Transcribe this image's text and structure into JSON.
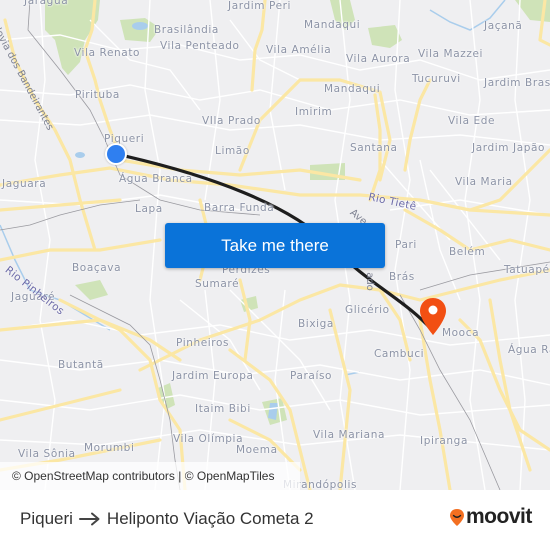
{
  "map": {
    "places": [
      {
        "name": "Jaraguá",
        "key": "jaragua"
      },
      {
        "name": "Jardim Peri",
        "key": "jardim-peri"
      },
      {
        "name": "Brasilândia",
        "key": "brasilandia"
      },
      {
        "name": "Vila Penteado",
        "key": "vila-penteado"
      },
      {
        "name": "Mandaqui",
        "key": "mandaqui-north"
      },
      {
        "name": "Jaçanã",
        "key": "jacana"
      },
      {
        "name": "Vila Renato",
        "key": "vila-renato"
      },
      {
        "name": "Vila Amélia",
        "key": "vila-amelia"
      },
      {
        "name": "Vila Aurora",
        "key": "vila-aurora"
      },
      {
        "name": "Vila Mazzei",
        "key": "vila-mazzei"
      },
      {
        "name": "Pirituba",
        "key": "pirituba"
      },
      {
        "name": "Tucuruvi",
        "key": "tucuruvi"
      },
      {
        "name": "Mandaqui",
        "key": "mandaqui"
      },
      {
        "name": "Jardim Brasil",
        "key": "jardim-brasil"
      },
      {
        "name": "Piqueri",
        "key": "piqueri"
      },
      {
        "name": "VIla Prado",
        "key": "vila-prado"
      },
      {
        "name": "Imirim",
        "key": "imirim"
      },
      {
        "name": "Vila Ede",
        "key": "vila-ede"
      },
      {
        "name": "Limão",
        "key": "limao"
      },
      {
        "name": "Santana",
        "key": "santana"
      },
      {
        "name": "Jardim Japão",
        "key": "jardim-japao"
      },
      {
        "name": "Jaguara",
        "key": "jaguara"
      },
      {
        "name": "Água Branca",
        "key": "agua-branca"
      },
      {
        "name": "Vila Maria",
        "key": "vila-maria"
      },
      {
        "name": "Lapa",
        "key": "lapa"
      },
      {
        "name": "Barra Funda",
        "key": "barra-funda"
      },
      {
        "name": "Pari",
        "key": "pari"
      },
      {
        "name": "Belém",
        "key": "belem"
      },
      {
        "name": "Boaçava",
        "key": "boacava"
      },
      {
        "name": "Perdizes",
        "key": "perdizes"
      },
      {
        "name": "Tatuapé",
        "key": "tatuape"
      },
      {
        "name": "Jaguaré",
        "key": "jaguare"
      },
      {
        "name": "Sumaré",
        "key": "sumare"
      },
      {
        "name": "Brás",
        "key": "bras"
      },
      {
        "name": "Glicério",
        "key": "glicerio"
      },
      {
        "name": "Bixiga",
        "key": "bixiga"
      },
      {
        "name": "Mooca",
        "key": "mooca"
      },
      {
        "name": "Pinheiros",
        "key": "pinheiros"
      },
      {
        "name": "Cambuci",
        "key": "cambuci"
      },
      {
        "name": "Água Ra",
        "key": "agua-rasa"
      },
      {
        "name": "Butantã",
        "key": "butanta"
      },
      {
        "name": "Jardim Europa",
        "key": "jardim-europa"
      },
      {
        "name": "Paraíso",
        "key": "paraiso"
      },
      {
        "name": "Itaim Bibi",
        "key": "itaim-bibi"
      },
      {
        "name": "Vila Olímpia",
        "key": "vila-olimpia"
      },
      {
        "name": "Vila Mariana",
        "key": "vila-mariana"
      },
      {
        "name": "Morumbi",
        "key": "morumbi"
      },
      {
        "name": "Vila Sônia",
        "key": "vila-sonia"
      },
      {
        "name": "Moema",
        "key": "moema"
      },
      {
        "name": "Ipiranga",
        "key": "ipiranga"
      },
      {
        "name": "Mirandópolis",
        "key": "mirandopolis"
      }
    ],
    "water_labels": {
      "rio_tiete": "Rio Tietê",
      "rio_pinheiros": "Rio Pinheiros"
    },
    "road_labels": {
      "rodovia_bandeirantes": "Rodovia dos Bandeirantes",
      "avenida": "Ave",
      "avenida_2": "ado"
    },
    "attribution": "© OpenStreetMap contributors | © OpenMapTiles",
    "origin": {
      "name": "Piqueri",
      "icon": "origin-dot-icon",
      "color": "#2f7ff0"
    },
    "destination": {
      "name": "Heliponto Viação Cometa 2",
      "icon": "map-pin-icon",
      "color": "#f24f13"
    }
  },
  "cta": {
    "label": "Take me there",
    "color": "#0a73d9"
  },
  "footer": {
    "from": "Piqueri",
    "arrow_icon": "arrow-right-icon",
    "to": "Heliponto Viação Cometa 2",
    "logo_text": "moovit",
    "logo_color": "#f36f21"
  }
}
